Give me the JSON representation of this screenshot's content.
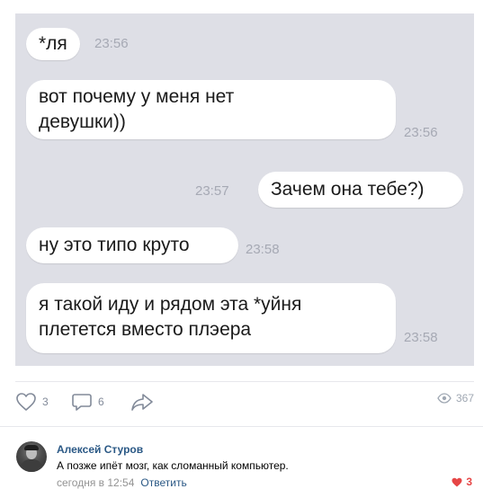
{
  "chat": {
    "messages": [
      {
        "text": "*ля",
        "time": "23:56",
        "side": "left"
      },
      {
        "text": "вот почему у меня нет\nдевушки))",
        "time": "23:56",
        "side": "left"
      },
      {
        "text": "Зачем она тебе?)",
        "time": "23:57",
        "side": "right"
      },
      {
        "text": "ну это типо круто",
        "time": "23:58",
        "side": "left"
      },
      {
        "text": "я такой иду и рядом эта *уйня\nплетется вместо плэера",
        "time": "23:58",
        "side": "left"
      }
    ]
  },
  "post": {
    "likes": "3",
    "comments": "6",
    "views": "367"
  },
  "comment": {
    "author": "Алексей Стуров",
    "text": "А позже ипёт мозг, как сломанный компьютер.",
    "time": "сегодня в 12:54",
    "reply_label": "Ответить",
    "likes": "3"
  },
  "colors": {
    "chat_background": "#dedfe6",
    "link": "#2a5885",
    "like_red": "#e64646"
  }
}
